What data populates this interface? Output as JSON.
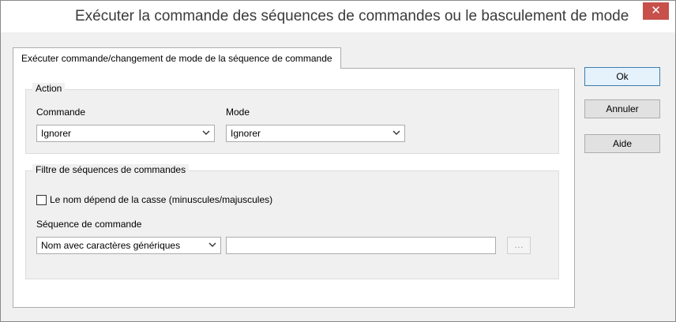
{
  "window": {
    "title": "Exécuter la commande des séquences de commandes ou le basculement de mode",
    "close_glyph": "✕"
  },
  "tab": {
    "label": "Exécuter commande/changement de mode de la séquence de commande"
  },
  "action": {
    "title": "Action",
    "command_label": "Commande",
    "command_value": "Ignorer",
    "mode_label": "Mode",
    "mode_value": "Ignorer"
  },
  "filter": {
    "title": "Filtre de séquences de commandes",
    "case_checkbox_label": "Le nom dépend de la casse (minuscules/majuscules)",
    "case_checked": false,
    "sequence_label": "Séquence de commande",
    "sequence_type_value": "Nom avec caractères génériques",
    "sequence_name_value": "",
    "browse_label": "…"
  },
  "buttons": {
    "ok": "Ok",
    "cancel": "Annuler",
    "help": "Aide"
  },
  "colors": {
    "close_button": "#c7504a",
    "default_button_border": "#3c7fb1"
  },
  "icons": {
    "close": "close-icon",
    "dropdown": "chevron-down-icon"
  }
}
